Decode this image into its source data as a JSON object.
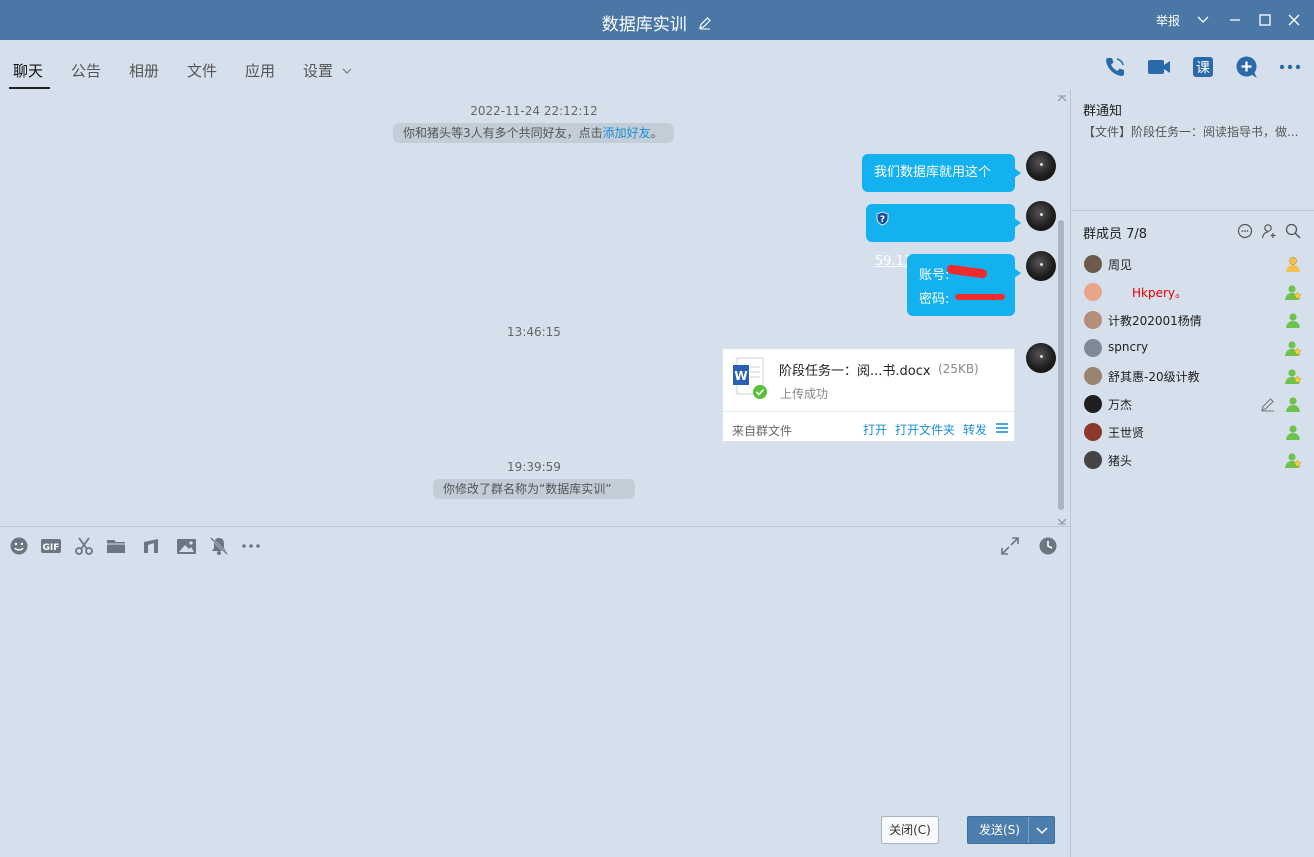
{
  "window": {
    "title": "数据库实训",
    "report_label": "举报"
  },
  "tabs": [
    {
      "label": "聊天",
      "active": true
    },
    {
      "label": "公告"
    },
    {
      "label": "相册"
    },
    {
      "label": "文件"
    },
    {
      "label": "应用"
    },
    {
      "label": "设置"
    }
  ],
  "toolbar_icons": [
    "phone-call-icon",
    "video-call-icon",
    "course-icon",
    "add-chat-icon",
    "more-icon"
  ],
  "course_label": "课",
  "chat": {
    "time1": "2022-11-24 22:12:12",
    "sys1_prefix": "你和猪头等3人有多个共同好友，点击",
    "sys1_link": "添加好友",
    "sys1_suffix": "。",
    "msg1": "我们数据库就用这个吧",
    "msg2": "59.110.25.50:8888",
    "msg3_line1": "账号:",
    "msg3_line2": "密码:",
    "time2": "13:46:15",
    "file": {
      "name": "阶段任务一：阅...书.docx",
      "size": "(25KB)",
      "status": "上传成功",
      "source": "来自群文件",
      "actions": [
        "打开",
        "打开文件夹",
        "转发"
      ]
    },
    "time3": "19:39:59",
    "sys2": "你修改了群名称为“数据库实训”"
  },
  "input_toolbar": [
    "emoji-icon",
    "gif-icon",
    "scissors-icon",
    "folder-icon",
    "music-note-icon",
    "image-icon",
    "mute-bell-icon",
    "more-icon",
    "expand-icon",
    "history-clock-icon"
  ],
  "gif_label": "GIF",
  "buttons": {
    "close": "关闭(C)",
    "send": "发送(S)"
  },
  "group_notice": {
    "title": "群通知",
    "text": "【文件】阶段任务一：阅读指导书，做..."
  },
  "members": {
    "title": "群成员 7/8",
    "list": [
      {
        "name": "周见",
        "role": "owner",
        "color": "#6b5a4a"
      },
      {
        "name": "Hkpery。",
        "role": "admin",
        "color": "#e8a58a",
        "red": true
      },
      {
        "name": "计教202001杨倩",
        "role": "member",
        "color": "#b58e7a"
      },
      {
        "name": "spncry",
        "role": "admin",
        "color": "#7f8a96"
      },
      {
        "name": "舒其惠-20级计教",
        "role": "admin",
        "color": "#9a8470"
      },
      {
        "name": "万杰",
        "role": "member",
        "color": "#1f1f1f"
      },
      {
        "name": "王世贤",
        "role": "member",
        "color": "#8a3a2a"
      },
      {
        "name": "猪头",
        "role": "admin",
        "color": "#444444"
      }
    ]
  },
  "colors": {
    "titlebar": "#4a77a5",
    "bubble": "#14b1f0",
    "background": "#d6e0ec",
    "link": "#1a8fd6"
  }
}
